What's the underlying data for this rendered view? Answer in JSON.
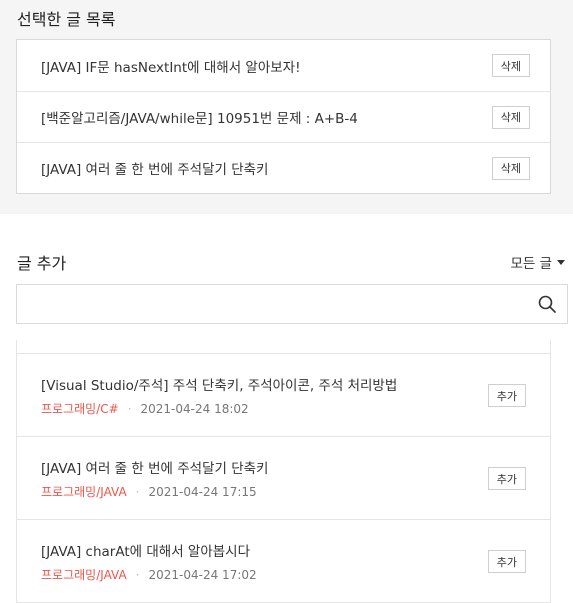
{
  "selected": {
    "title": "선택한 글 목록",
    "items": [
      {
        "title": "[JAVA] IF문 hasNextInt에 대해서 알아보자!",
        "button": "삭제"
      },
      {
        "title": "[백준알고리즘/JAVA/while문] 10951번 문제 : A+B-4",
        "button": "삭제"
      },
      {
        "title": "[JAVA] 여러 줄 한 번에 주석달기 단축키",
        "button": "삭제"
      }
    ]
  },
  "add": {
    "title": "글 추가",
    "filter_label": "모든 글",
    "search_value": "",
    "results": [
      {
        "title": "[Visual Studio/주석] 주석 단축키, 주석아이콘, 주석 처리방법",
        "category": "프로그래밍/C#",
        "date": "2021-04-24 18:02",
        "button": "추가"
      },
      {
        "title": "[JAVA] 여러 줄 한 번에 주석달기 단축키",
        "category": "프로그래밍/JAVA",
        "date": "2021-04-24 17:15",
        "button": "추가"
      },
      {
        "title": "[JAVA] charAt에 대해서 알아봅시다",
        "category": "프로그래밍/JAVA",
        "date": "2021-04-24 17:02",
        "button": "추가"
      }
    ]
  },
  "colors": {
    "category": "#f0554b",
    "border": "#d9d9d9",
    "section_bg": "#f5f5f5"
  },
  "icons": {
    "search": "search-icon",
    "filter": "caret-down-icon"
  }
}
